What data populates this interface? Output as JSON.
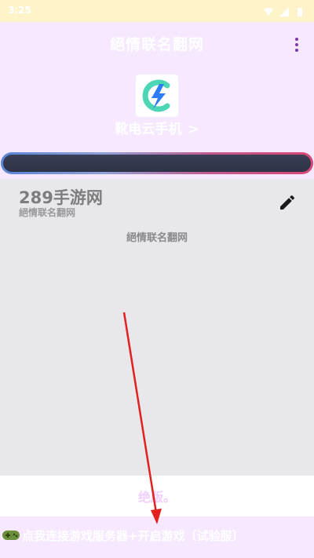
{
  "status_bar": {
    "time": "3:25"
  },
  "header": {
    "title": "絕情联名翻网",
    "cloud_phone_label": "靴电云手机",
    "cloud_phone_chevron": ">"
  },
  "card": {
    "title": "289手游网",
    "subtitle": "絕情联名翻网",
    "center_text": "絕情联名翻网"
  },
  "hint_text": "绝版。",
  "bottom_bar": {
    "text": "点我连接游戏服务器+开启游戏〔试验服〕"
  },
  "colors": {
    "accent": "#7a3aa8",
    "progress_left": "#5a86d6",
    "progress_right": "#d84775",
    "header_bg": "#f6e8ff",
    "card_bg": "#e8e7ec"
  }
}
